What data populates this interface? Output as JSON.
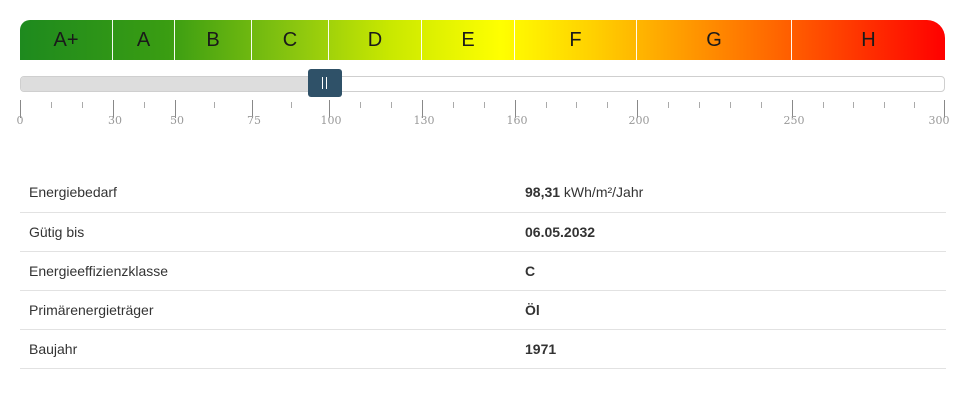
{
  "energy_scale": {
    "classes": [
      {
        "label": "A+",
        "from": 0,
        "to": 30
      },
      {
        "label": "A",
        "from": 30,
        "to": 50
      },
      {
        "label": "B",
        "from": 50,
        "to": 75
      },
      {
        "label": "C",
        "from": 75,
        "to": 100
      },
      {
        "label": "D",
        "from": 100,
        "to": 130
      },
      {
        "label": "E",
        "from": 130,
        "to": 160
      },
      {
        "label": "F",
        "from": 160,
        "to": 200
      },
      {
        "label": "G",
        "from": 200,
        "to": 250
      },
      {
        "label": "H",
        "from": 250,
        "to": 300
      }
    ],
    "tick_labels": [
      "0",
      "30",
      "50",
      "75",
      "100",
      "130",
      "160",
      "200",
      "250",
      "300"
    ],
    "current_value": 98.31,
    "max": 300
  },
  "details": {
    "rows": [
      {
        "label": "Energiebedarf",
        "value_bold": "98,31",
        "value_unit": " kWh/m²/Jahr"
      },
      {
        "label": "Gütig bis",
        "value_bold": "06.05.2032",
        "value_unit": ""
      },
      {
        "label": "Energieeffizienzklasse",
        "value_bold": "C",
        "value_unit": ""
      },
      {
        "label": "Primärenergieträger",
        "value_bold": "Öl",
        "value_unit": ""
      },
      {
        "label": "Baujahr",
        "value_bold": "1971",
        "value_unit": ""
      }
    ]
  }
}
